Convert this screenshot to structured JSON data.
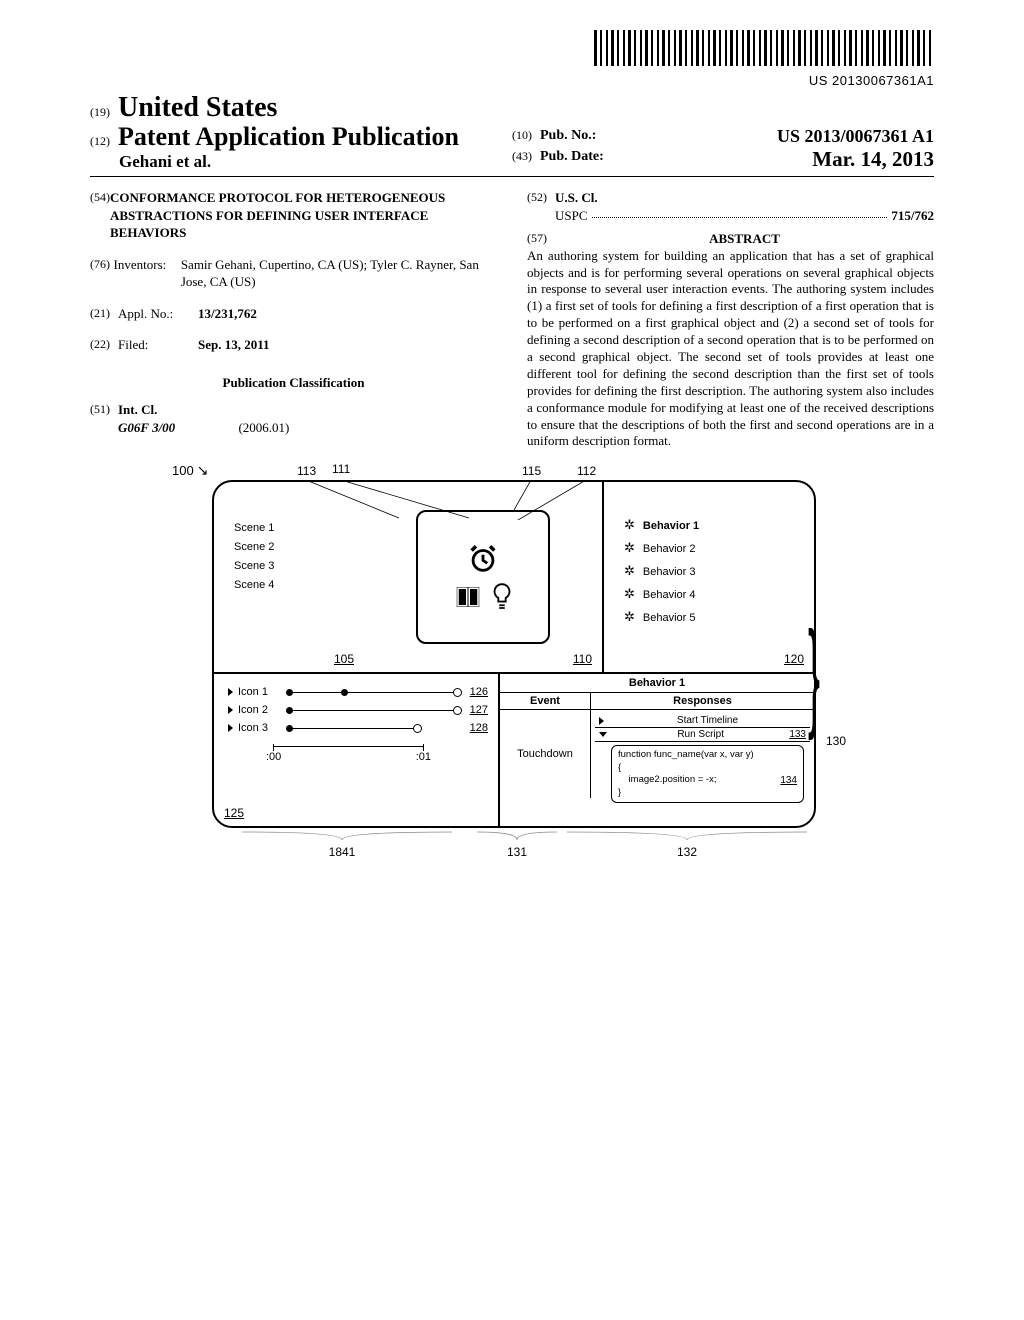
{
  "barcode_text": "US 20130067361A1",
  "header": {
    "country_code": "(19)",
    "country": "United States",
    "doc_type_code": "(12)",
    "doc_type": "Patent Application Publication",
    "authors": "Gehani et al.",
    "pub_no_code": "(10)",
    "pub_no_label": "Pub. No.:",
    "pub_no_value": "US 2013/0067361 A1",
    "pub_date_code": "(43)",
    "pub_date_label": "Pub. Date:",
    "pub_date_value": "Mar. 14, 2013"
  },
  "title": {
    "code": "(54)",
    "text": "CONFORMANCE PROTOCOL FOR HETEROGENEOUS ABSTRACTIONS FOR DEFINING USER INTERFACE BEHAVIORS"
  },
  "inventors": {
    "code": "(76)",
    "label": "Inventors:",
    "names": "Samir Gehani, Cupertino, CA (US); Tyler C. Rayner, San Jose, CA (US)"
  },
  "appl": {
    "code": "(21)",
    "label": "Appl. No.:",
    "value": "13/231,762"
  },
  "filed": {
    "code": "(22)",
    "label": "Filed:",
    "value": "Sep. 13, 2011"
  },
  "pub_class_heading": "Publication Classification",
  "intcl": {
    "code": "(51)",
    "label": "Int. Cl.",
    "class": "G06F 3/00",
    "edition": "(2006.01)"
  },
  "uscl": {
    "code": "(52)",
    "label": "U.S. Cl.",
    "system": "USPC",
    "value": "715/762"
  },
  "abstract": {
    "code": "(57)",
    "heading": "ABSTRACT",
    "text": "An authoring system for building an application that has a set of graphical objects and is for performing several operations on several graphical objects in response to several user interaction events. The authoring system includes (1) a first set of tools for defining a first description of a first operation that is to be performed on a first graphical object and (2) a second set of tools for defining a second description of a second operation that is to be performed on a second graphical object. The second set of tools provides at least one different tool for defining the second description than the first set of tools provides for defining the first description. The authoring system also includes a conformance module for modifying at least one of the received descriptions to ensure that the descriptions of both the first and second operations are in a uniform description format."
  },
  "figure": {
    "ref_100": "100",
    "ref_113": "113",
    "ref_111": "111",
    "ref_115": "115",
    "ref_112": "112",
    "scenes": [
      "Scene 1",
      "Scene 2",
      "Scene 3",
      "Scene 4"
    ],
    "ref_105": "105",
    "ref_110": "110",
    "ref_120": "120",
    "behaviors": [
      "Behavior 1",
      "Behavior 2",
      "Behavior 3",
      "Behavior 4",
      "Behavior 5"
    ],
    "timeline": {
      "icons": [
        "Icon 1",
        "Icon 2",
        "Icon 3"
      ],
      "ref_125": "125",
      "ref_126": "126",
      "ref_127": "127",
      "ref_128": "128",
      "time0": ":00",
      "time1": ":01",
      "ref_1841": "1841"
    },
    "detail": {
      "title": "Behavior 1",
      "event_header": "Event",
      "resp_header": "Responses",
      "event_value": "Touchdown",
      "resp1": "Start Timeline",
      "resp2": "Run Script",
      "ref_133": "133",
      "code_line1": "function func_name(var x, var y)",
      "code_line2": "{",
      "code_line3": "    image2.position = -x;",
      "code_line4": "}",
      "ref_134": "134",
      "ref_130": "130",
      "ref_131": "131",
      "ref_132": "132"
    }
  }
}
